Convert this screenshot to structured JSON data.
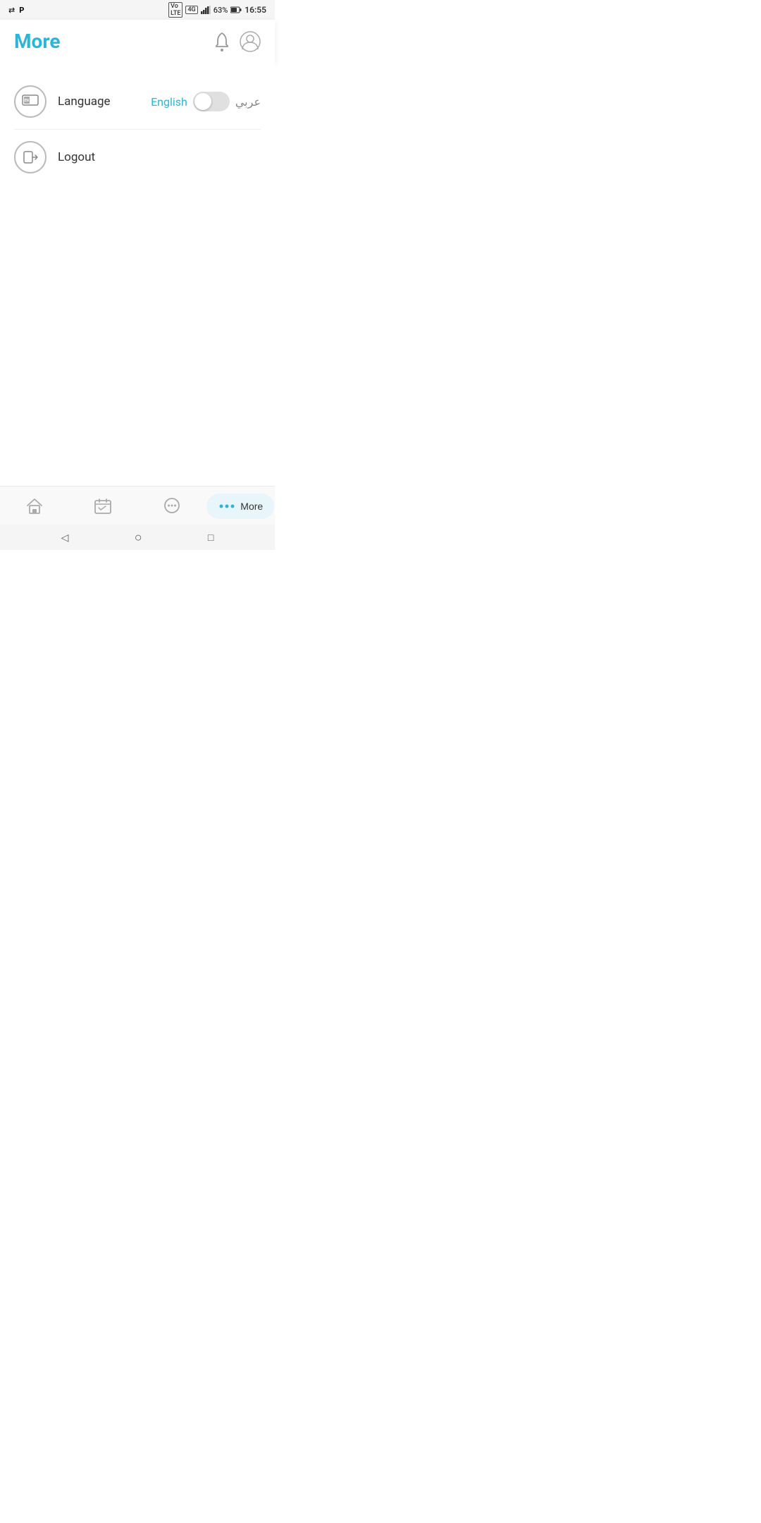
{
  "statusBar": {
    "leftIcons": [
      "usb-icon",
      "parking-icon"
    ],
    "rightIcons": [
      "vo-lte-icon",
      "4g-icon",
      "signal-icon",
      "battery-icon"
    ],
    "battery": "63%",
    "time": "16:55"
  },
  "header": {
    "title": "More",
    "notificationIcon": "bell-icon",
    "profileIcon": "profile-icon"
  },
  "menu": {
    "items": [
      {
        "id": "language",
        "icon": "language-icon",
        "label": "Language",
        "rightEnglish": "English",
        "rightArabic": "عربي",
        "hasToggle": true
      },
      {
        "id": "logout",
        "icon": "logout-icon",
        "label": "Logout",
        "hasToggle": false
      }
    ]
  },
  "bottomNav": {
    "items": [
      {
        "id": "home",
        "icon": "home-icon",
        "label": "",
        "active": false
      },
      {
        "id": "calendar",
        "icon": "calendar-icon",
        "label": "",
        "active": false
      },
      {
        "id": "chat",
        "icon": "chat-icon",
        "label": "",
        "active": false
      },
      {
        "id": "more",
        "icon": "more-dots-icon",
        "label": "More",
        "active": true
      }
    ]
  },
  "sysNav": {
    "back": "◁",
    "home": "○",
    "recents": "□"
  }
}
